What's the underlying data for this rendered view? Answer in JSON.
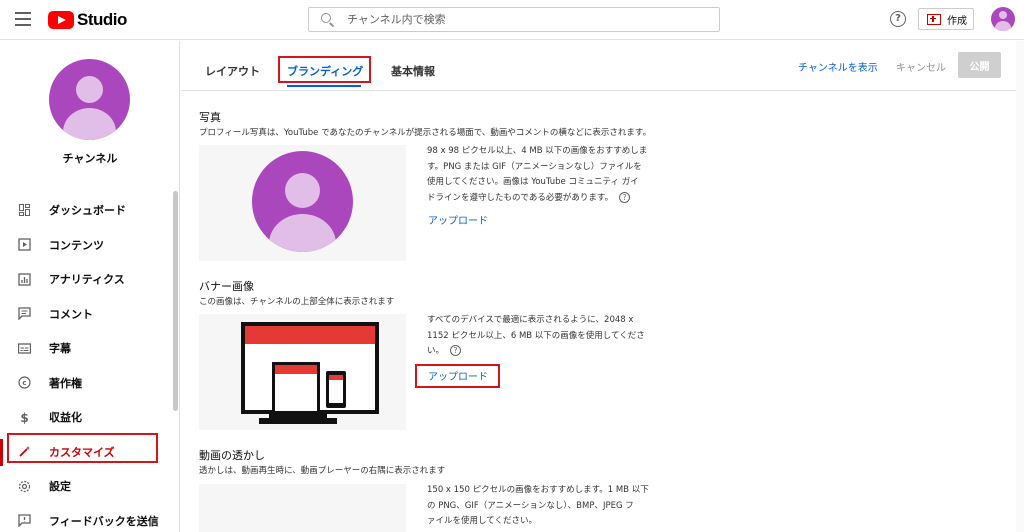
{
  "app": {
    "logo_text": "Studio"
  },
  "search": {
    "placeholder": "チャンネル内で検索"
  },
  "header": {
    "help_label": "?",
    "create_label": "作成"
  },
  "sidebar": {
    "channel_name": "チャンネル",
    "items": [
      {
        "label": "ダッシュボード",
        "icon": "dashboard-icon"
      },
      {
        "label": "コンテンツ",
        "icon": "content-icon"
      },
      {
        "label": "アナリティクス",
        "icon": "analytics-icon"
      },
      {
        "label": "コメント",
        "icon": "comments-icon"
      },
      {
        "label": "字幕",
        "icon": "subtitles-icon"
      },
      {
        "label": "著作権",
        "icon": "copyright-icon"
      },
      {
        "label": "収益化",
        "icon": "monetization-icon"
      },
      {
        "label": "カスタマイズ",
        "icon": "customize-icon",
        "active": true
      },
      {
        "label": "設定",
        "icon": "settings-icon"
      },
      {
        "label": "フィードバックを送信",
        "icon": "feedback-icon"
      }
    ]
  },
  "tabs": [
    {
      "label": "レイアウト"
    },
    {
      "label": "ブランディング",
      "active": true
    },
    {
      "label": "基本情報"
    }
  ],
  "actions": {
    "view_channel": "チャンネルを表示",
    "cancel": "キャンセル",
    "publish": "公開"
  },
  "photo": {
    "title": "写真",
    "description": "プロフィール写真は、YouTube であなたのチャンネルが提示される場面で、動画やコメントの横などに表示されます。",
    "info_lines": [
      "98 x 98 ピクセル以上、4 MB 以下の画像をおすすめしま",
      "す。PNG または GIF（アニメーションなし）ファイルを",
      "使用してください。画像は YouTube コミュニティ ガイ",
      "ドラインを遵守したものである必要があります。"
    ],
    "help": "?",
    "upload": "アップロード"
  },
  "banner": {
    "title": "バナー画像",
    "description": "この画像は、チャンネルの上部全体に表示されます",
    "info_lines": [
      "すべてのデバイスで最適に表示されるように、2048 x",
      "1152 ピクセル以上、6 MB 以下の画像を使用してくださ",
      "い。"
    ],
    "help": "?",
    "upload": "アップロード"
  },
  "watermark": {
    "title": "動画の透かし",
    "description": "透かしは、動画再生時に、動画プレーヤーの右隅に表示されます",
    "info_lines": [
      "150 x 150 ピクセルの画像をおすすめします。1 MB 以下",
      "の PNG、GIF（アニメーションなし）、BMP、JPEG フ",
      "ァイルを使用してください。"
    ]
  },
  "colors": {
    "brand_red": "#ff0000",
    "accent_blue": "#065fd4",
    "avatar_purple": "#ab47bc",
    "highlight_red": "#d0161e"
  }
}
